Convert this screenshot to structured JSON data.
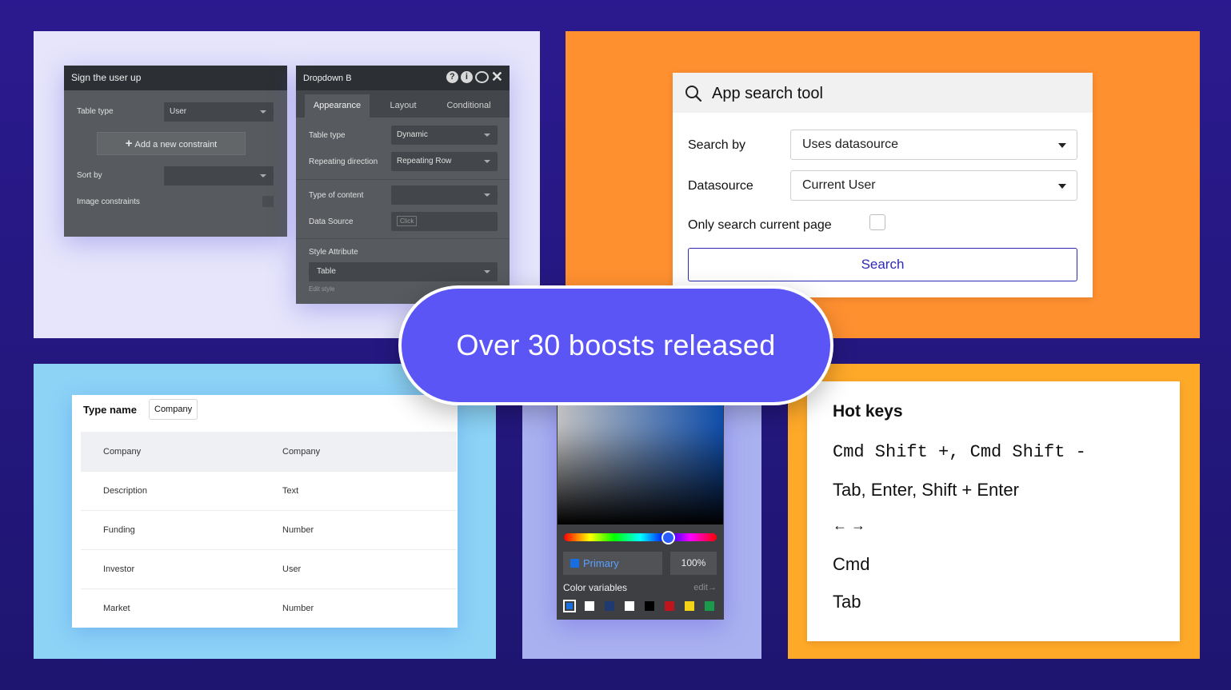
{
  "headline": "Over 30 boosts released",
  "sign_up_panel": {
    "title": "Sign the user up",
    "table_type_label": "Table type",
    "table_type_value": "User",
    "add_constraint": "Add a new constraint",
    "sort_by_label": "Sort by",
    "image_constraints_label": "Image constraints"
  },
  "dropdown_panel": {
    "title": "Dropdown B",
    "tabs": [
      "Appearance",
      "Layout",
      "Conditional"
    ],
    "table_type_label": "Table type",
    "table_type_value": "Dynamic",
    "repeating_direction_label": "Repeating direction",
    "repeating_direction_value": "Repeating Row",
    "type_of_content_label": "Type of content",
    "data_source_label": "Data Source",
    "data_source_placeholder": "Click",
    "style_attribute_label": "Style Attribute",
    "style_value": "Table",
    "edit_style": "Edit style"
  },
  "search_tool": {
    "title": "App search tool",
    "search_by_label": "Search by",
    "search_by_value": "Uses datasource",
    "datasource_label": "Datasource",
    "datasource_value": "Current User",
    "only_current_label": "Only search current page",
    "search_button": "Search"
  },
  "type_table": {
    "type_name_label": "Type name",
    "type_name_value": "Company",
    "rows": [
      {
        "field": "Company",
        "type": "Company"
      },
      {
        "field": "Description",
        "type": "Text"
      },
      {
        "field": "Funding",
        "type": "Number"
      },
      {
        "field": "Investor",
        "type": "User"
      },
      {
        "field": "Market",
        "type": "Number"
      }
    ]
  },
  "color_picker": {
    "primary_label": "Primary",
    "opacity": "100%",
    "color_variables_label": "Color variables",
    "edit_link": "edit→",
    "hue_position": 0.68,
    "swatches": [
      "#1a6fe0",
      "#ffffff",
      "#1f3a70",
      "#ffffff",
      "#000000",
      "#c0141c",
      "#f3d417",
      "#1a9a4b"
    ]
  },
  "hot_keys": {
    "title": "Hot keys",
    "lines": [
      "Cmd Shift +, Cmd Shift -",
      "Tab, Enter, Shift + Enter",
      "← →",
      "Cmd",
      "Tab"
    ]
  }
}
